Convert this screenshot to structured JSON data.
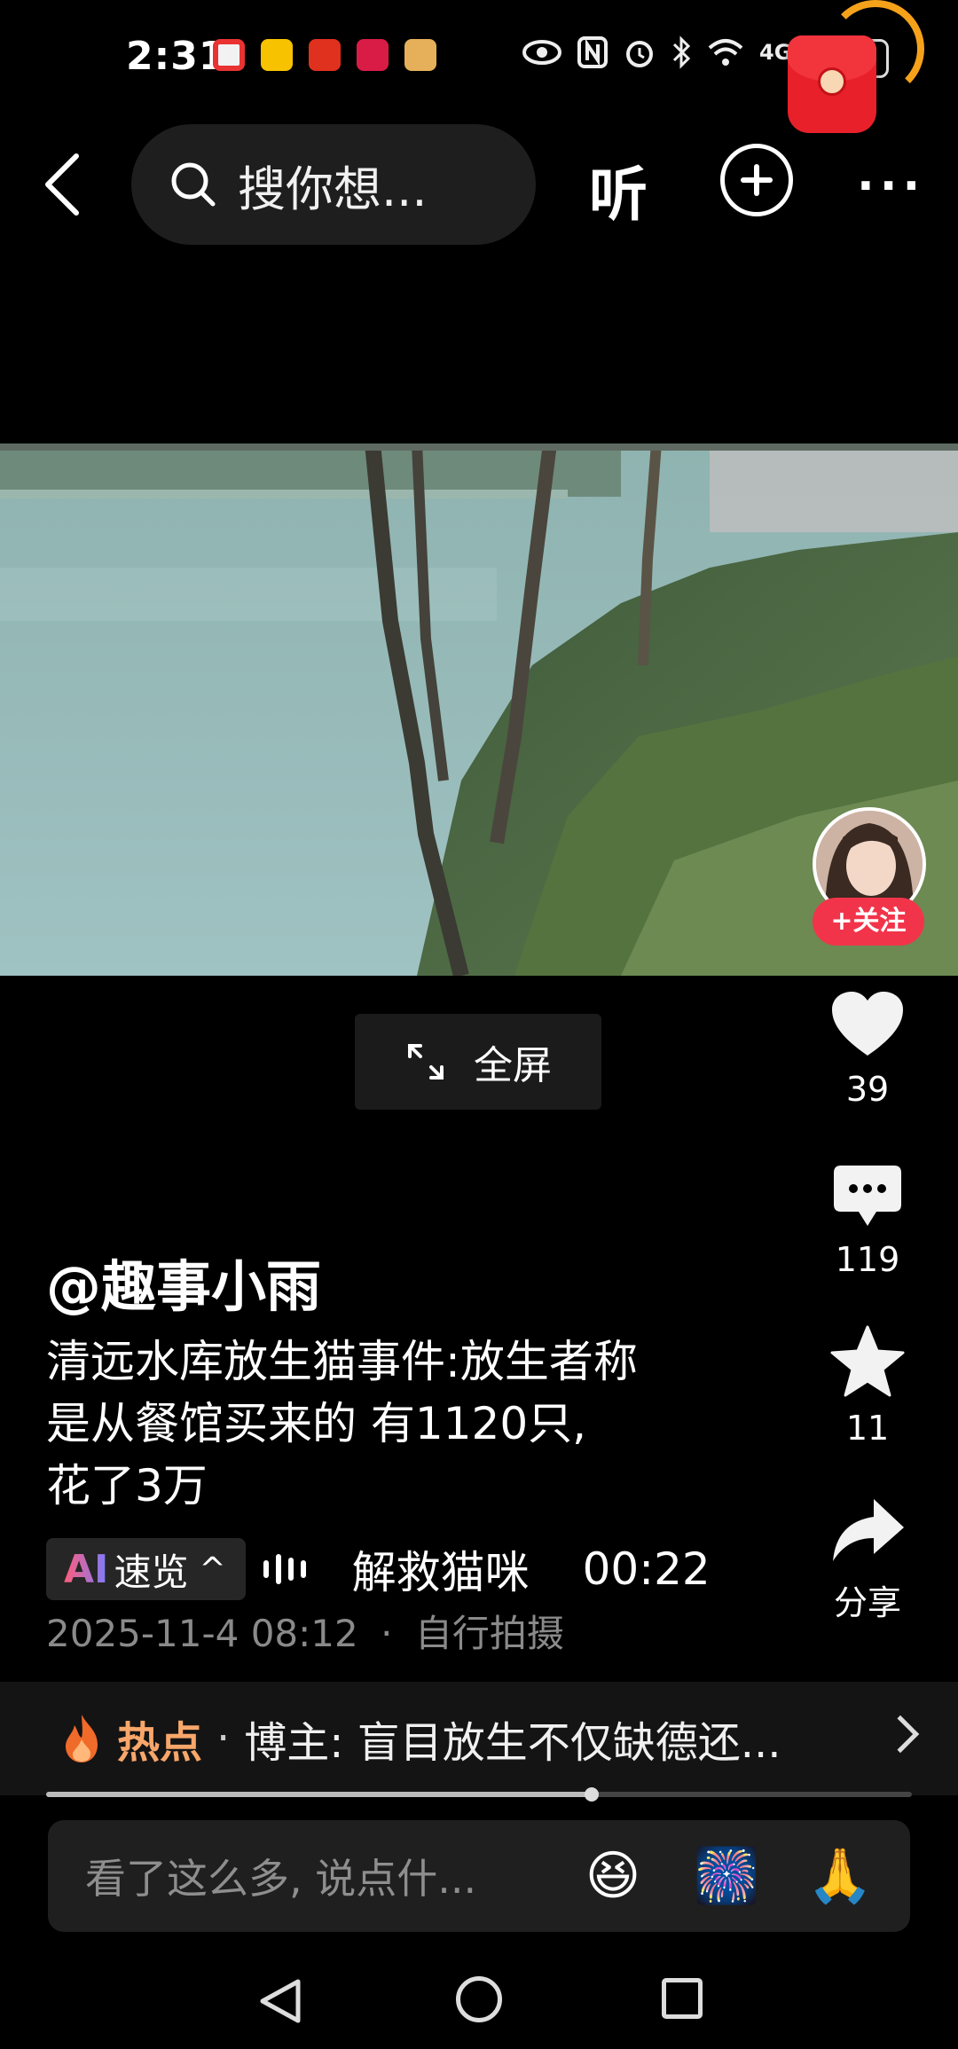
{
  "status_bar": {
    "time": "2:31",
    "network": "4G",
    "battery": "20"
  },
  "top_nav": {
    "search_text": "搜你想...",
    "listen_label": "听",
    "more_label": "···"
  },
  "video": {
    "fullscreen_label": "全屏"
  },
  "author": {
    "follow_label": "+关注",
    "name": "@趣事小雨"
  },
  "actions": {
    "likes": "39",
    "comments": "119",
    "favorites": "11",
    "share_label": "分享"
  },
  "post": {
    "caption_lines": [
      "清远水库放生猫事件:放生者称",
      "是从餐馆买来的 有1120只,",
      "花了3万"
    ],
    "ai_label_prefix": "AI",
    "ai_label": "速览",
    "ai_chevron": "^",
    "ai_topic": "解救猫咪",
    "ai_duration": "00:22",
    "date": "2025-11-4 08:12",
    "separator": "·",
    "source": "自行拍摄"
  },
  "hot_bar": {
    "label": "热点",
    "separator": "·",
    "text": "博主: 盲目放生不仅缺德还..."
  },
  "progress": {
    "fraction": 0.63
  },
  "comment_bar": {
    "placeholder": "看了这么多, 说点什...",
    "emojis": [
      "😆",
      "🎆",
      "🙏"
    ]
  },
  "colors": {
    "follow": "#f2344a",
    "hot_label": "#f8a66a",
    "background": "#000000"
  }
}
